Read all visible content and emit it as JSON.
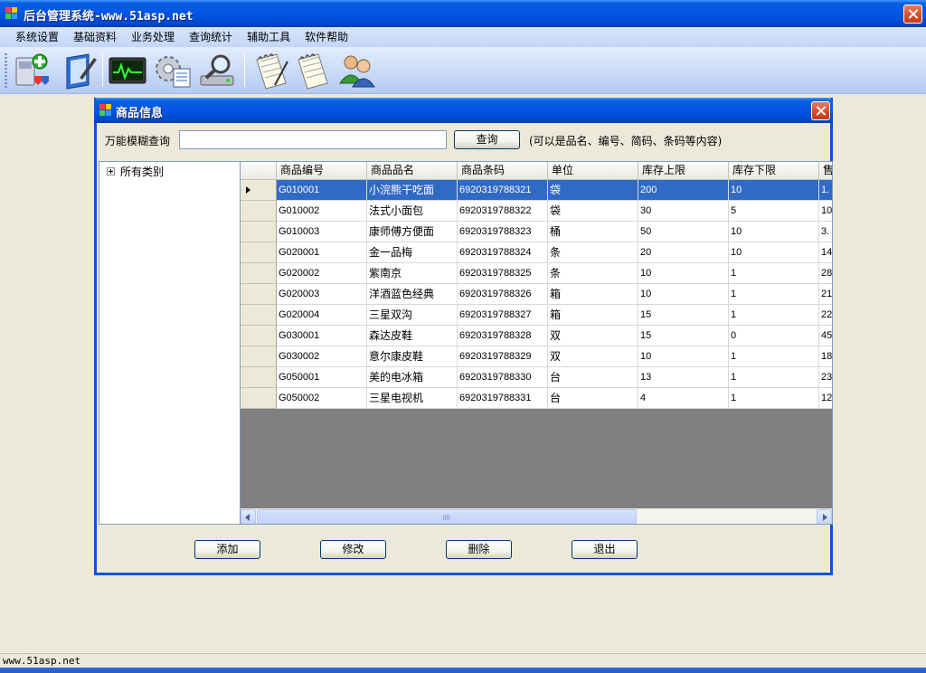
{
  "window": {
    "title": "后台管理系统-www.51asp.net"
  },
  "menu": [
    "系统设置",
    "基础资料",
    "业务处理",
    "查询统计",
    "辅助工具",
    "软件帮助"
  ],
  "toolbar": {
    "icons": [
      "install-icon",
      "edit-icon",
      "monitor-icon",
      "settings-icon",
      "search-drive-icon",
      "notepad-icon",
      "notepad-icon",
      "users-icon"
    ]
  },
  "dialog": {
    "title": "商品信息",
    "search": {
      "label": "万能模糊查询",
      "value": "",
      "button": "查询",
      "hint": "(可以是品名、编号、简码、条码等内容)"
    },
    "tree": {
      "root": "所有类别"
    },
    "grid": {
      "columns": [
        "商品编号",
        "商品品名",
        "商品条码",
        "单位",
        "库存上限",
        "库存下限",
        "售"
      ],
      "selected_row": 0,
      "rows": [
        [
          "G010001",
          "小浣熊干吃面",
          "6920319788321",
          "袋",
          "200",
          "10",
          "1."
        ],
        [
          "G010002",
          "法式小面包",
          "6920319788322",
          "袋",
          "30",
          "5",
          "10"
        ],
        [
          "G010003",
          "康师傅方便面",
          "6920319788323",
          "桶",
          "50",
          "10",
          "3."
        ],
        [
          "G020001",
          "金一品梅",
          "6920319788324",
          "条",
          "20",
          "10",
          "14"
        ],
        [
          "G020002",
          "紫南京",
          "6920319788325",
          "条",
          "10",
          "1",
          "28"
        ],
        [
          "G020003",
          "洋酒蓝色经典",
          "6920319788326",
          "箱",
          "10",
          "1",
          "21"
        ],
        [
          "G020004",
          "三星双沟",
          "6920319788327",
          "箱",
          "15",
          "1",
          "22"
        ],
        [
          "G030001",
          "森达皮鞋",
          "6920319788328",
          "双",
          "15",
          "0",
          "45"
        ],
        [
          "G030002",
          "意尔康皮鞋",
          "6920319788329",
          "双",
          "10",
          "1",
          "18"
        ],
        [
          "G050001",
          "美的电冰箱",
          "6920319788330",
          "台",
          "13",
          "1",
          "23"
        ],
        [
          "G050002",
          "三星电视机",
          "6920319788331",
          "台",
          "4",
          "1",
          "12"
        ]
      ]
    },
    "buttons": {
      "add": "添加",
      "edit": "修改",
      "delete": "删除",
      "exit": "退出"
    }
  },
  "status": {
    "text": "www.51asp.net"
  },
  "colors": {
    "title_blue": "#0055e5",
    "selection": "#316ac5",
    "grid_empty": "#808080",
    "face": "#ece9d8"
  }
}
